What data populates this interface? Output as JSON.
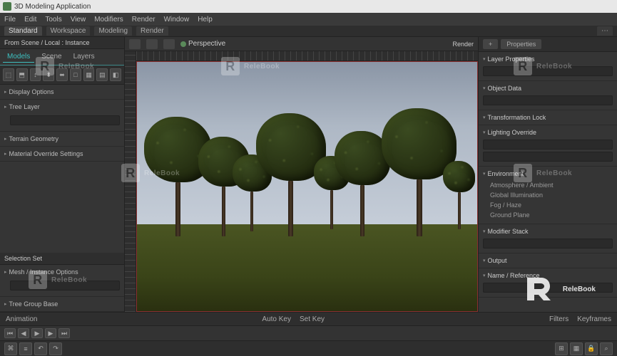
{
  "title": "3D Modeling Application",
  "menu": [
    "File",
    "Edit",
    "Tools",
    "View",
    "Modifiers",
    "Render",
    "Window",
    "Help"
  ],
  "tabs": [
    {
      "label": "Standard"
    },
    {
      "label": "Workspace"
    },
    {
      "label": "Modeling"
    },
    {
      "label": "Render"
    }
  ],
  "left": {
    "header": "From Scene / Local : Instance",
    "subtabs": [
      "Models",
      "Scene",
      "Layers"
    ],
    "toolbuttons": [
      "⬚",
      "⬒",
      "↕",
      "⬍",
      "⬌",
      "□",
      "▦",
      "▤",
      "◧"
    ],
    "sections": [
      {
        "hdr": "Display Options"
      },
      {
        "hdr": "Tree Layer"
      },
      {
        "hdr": "Terrain Geometry"
      },
      {
        "hdr": "Material Override Settings"
      }
    ],
    "lower_header": "Selection Set",
    "lower_items": [
      "Mesh / Instance Options",
      "Tree Group Base"
    ]
  },
  "center": {
    "viewlabel": "Perspective",
    "mode": "Render"
  },
  "right": {
    "toptabs": [
      "+",
      "Properties"
    ],
    "header1": "Layer Properties",
    "panel1": "Object Data",
    "panel2": "Transformation Lock",
    "panel3": "Lighting Override",
    "subhdr": "Environment",
    "list": [
      "Atmosphere / Ambient",
      "Global Illumination",
      "Fog / Haze",
      "Ground Plane"
    ],
    "lower1": "Modifier Stack",
    "lower2": "Output",
    "lower3": "Name / Reference"
  },
  "timeline": {
    "left_label": "Animation",
    "center_a": "Auto Key",
    "center_b": "Set Key",
    "right_a": "Filters",
    "right_b": "Keyframes"
  },
  "watermark": "ReleBook"
}
